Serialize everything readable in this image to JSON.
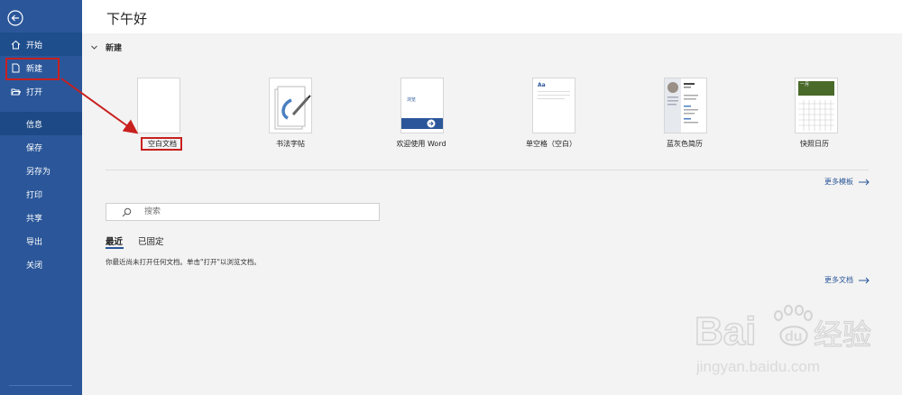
{
  "sidebar": {
    "items": [
      {
        "label": "开始"
      },
      {
        "label": "新建"
      },
      {
        "label": "打开"
      },
      {
        "label": "信息"
      },
      {
        "label": "保存"
      },
      {
        "label": "另存为"
      },
      {
        "label": "打印"
      },
      {
        "label": "共享"
      },
      {
        "label": "导出"
      },
      {
        "label": "关闭"
      }
    ]
  },
  "header": {
    "greeting": "下午好"
  },
  "new_section": {
    "title": "新建",
    "templates": [
      {
        "label": "空白文档"
      },
      {
        "label": "书法字帖"
      },
      {
        "label": "欢迎使用 Word",
        "thumb_text": "浏览"
      },
      {
        "label": "单空格（空白）",
        "thumb_text": "Aa"
      },
      {
        "label": "蓝灰色简历"
      },
      {
        "label": "快照日历",
        "thumb_text": "一月"
      }
    ],
    "more_templates": "更多模板"
  },
  "search": {
    "placeholder": "搜索"
  },
  "tabs": [
    {
      "label": "最近"
    },
    {
      "label": "已固定"
    }
  ],
  "recent": {
    "empty_message": "你最近尚未打开任何文档。单击\"打开\"以浏览文档。",
    "more_documents": "更多文档"
  },
  "watermark": {
    "brand": "Bai",
    "brand2": "du",
    "cn": "经验",
    "url": "jingyan.baidu.com"
  },
  "colors": {
    "accent": "#2b579a",
    "highlight": "#c8201f",
    "sidebar": "#2b579a"
  }
}
